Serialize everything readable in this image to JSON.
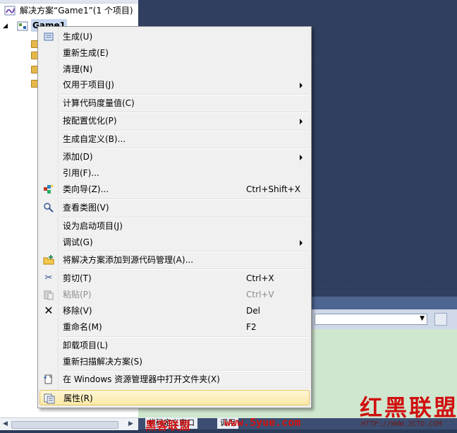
{
  "explorer": {
    "solution_label": "解决方案“Game1”(1 个项目)",
    "project_label": "Game1"
  },
  "menu": {
    "items": [
      {
        "label": "生成(U)",
        "shortcut": "",
        "submenu": false,
        "icon": "build-icon"
      },
      {
        "label": "重新生成(E)",
        "shortcut": "",
        "submenu": false,
        "icon": ""
      },
      {
        "label": "清理(N)",
        "shortcut": "",
        "submenu": false,
        "icon": ""
      },
      {
        "label": "仅用于项目(J)",
        "shortcut": "",
        "submenu": true,
        "icon": ""
      },
      {
        "label": "计算代码度量值(C)",
        "shortcut": "",
        "submenu": false,
        "icon": ""
      },
      {
        "label": "按配置优化(P)",
        "shortcut": "",
        "submenu": true,
        "icon": ""
      },
      {
        "label": "生成自定义(B)...",
        "shortcut": "",
        "submenu": false,
        "icon": ""
      },
      {
        "label": "添加(D)",
        "shortcut": "",
        "submenu": true,
        "icon": ""
      },
      {
        "label": "引用(F)...",
        "shortcut": "",
        "submenu": false,
        "icon": ""
      },
      {
        "label": "类向导(Z)...",
        "shortcut": "Ctrl+Shift+X",
        "submenu": false,
        "icon": "class-wizard-icon"
      },
      {
        "label": "查看类图(V)",
        "shortcut": "",
        "submenu": false,
        "icon": "class-diagram-icon"
      },
      {
        "label": "设为启动项目(J)",
        "shortcut": "",
        "submenu": false,
        "icon": ""
      },
      {
        "label": "调试(G)",
        "shortcut": "",
        "submenu": true,
        "icon": ""
      },
      {
        "label": "将解决方案添加到源代码管理(A)...",
        "shortcut": "",
        "submenu": false,
        "icon": "source-control-icon"
      },
      {
        "label": "剪切(T)",
        "shortcut": "Ctrl+X",
        "submenu": false,
        "icon": "scissors-icon"
      },
      {
        "label": "粘贴(P)",
        "shortcut": "Ctrl+V",
        "submenu": false,
        "icon": "paste-icon",
        "disabled": true
      },
      {
        "label": "移除(V)",
        "shortcut": "Del",
        "submenu": false,
        "icon": "remove-icon"
      },
      {
        "label": "重命名(M)",
        "shortcut": "F2",
        "submenu": false,
        "icon": ""
      },
      {
        "label": "卸载项目(L)",
        "shortcut": "",
        "submenu": false,
        "icon": ""
      },
      {
        "label": "重新扫描解决方案(S)",
        "shortcut": "",
        "submenu": false,
        "icon": ""
      },
      {
        "label": "在 Windows 资源管理器中打开文件夹(X)",
        "shortcut": "",
        "submenu": false,
        "icon": "open-folder-icon"
      },
      {
        "label": "属性(R)",
        "shortcut": "",
        "submenu": false,
        "icon": "properties-icon",
        "highlighted": true
      }
    ]
  },
  "bottom_tabs": {
    "tab1": "代码定义窗口",
    "tab2": "调用"
  },
  "watermark": {
    "brand": "红黑联盟",
    "site_cn": "黑客联盟",
    "site_url": "www.5yue.com",
    "url_small": "HTTP://WWW.2CTO.COM"
  }
}
